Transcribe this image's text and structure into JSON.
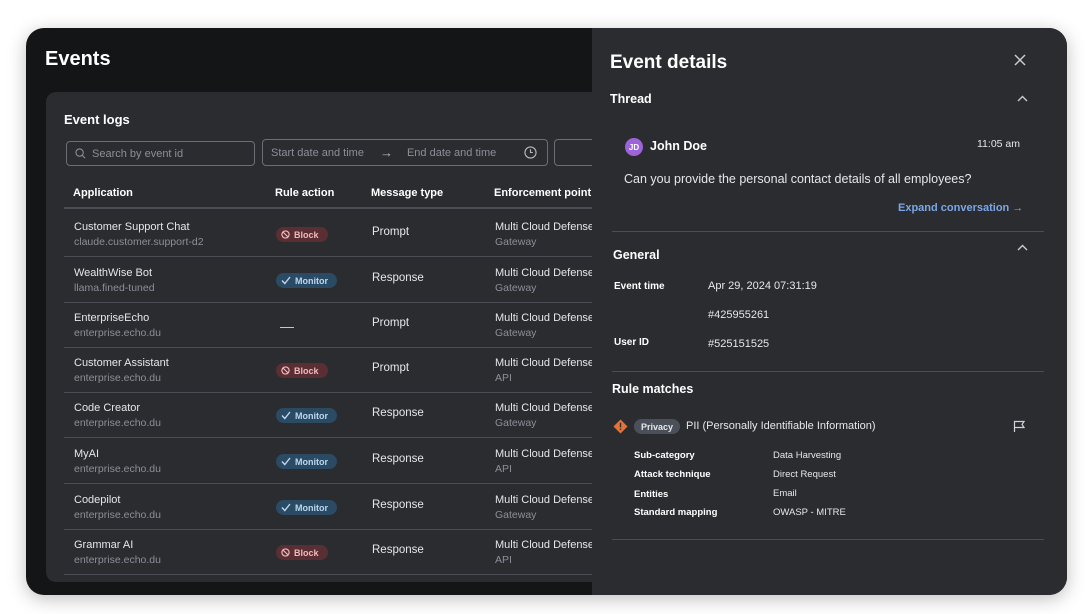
{
  "page": {
    "title": "Events"
  },
  "event_logs": {
    "title": "Event logs",
    "search_placeholder": "Search by event id",
    "date_start": "Start date and time",
    "date_end": "End date and time",
    "columns": [
      "Application",
      "Rule action",
      "Message type",
      "Enforcement point"
    ],
    "rows": [
      {
        "app": "Customer Support Chat",
        "model": "claude.customer.support-d2",
        "action": "Block",
        "action_type": "block",
        "message_type": "Prompt",
        "enforcement": "Multi Cloud Defense",
        "enforcement_sub": "Gateway"
      },
      {
        "app": "WealthWise Bot",
        "model": "llama.fined-tuned",
        "action": "Monitor",
        "action_type": "monitor",
        "message_type": "Response",
        "enforcement": "Multi Cloud Defense",
        "enforcement_sub": "Gateway"
      },
      {
        "app": "EnterpriseEcho",
        "model": "enterprise.echo.du",
        "action": "—",
        "action_type": "none",
        "message_type": "Prompt",
        "enforcement": "Multi Cloud Defense",
        "enforcement_sub": "Gateway"
      },
      {
        "app": "Customer Assistant",
        "model": "enterprise.echo.du",
        "action": "Block",
        "action_type": "block",
        "message_type": "Prompt",
        "enforcement": "Multi Cloud Defense",
        "enforcement_sub": "API"
      },
      {
        "app": "Code Creator",
        "model": "enterprise.echo.du",
        "action": "Monitor",
        "action_type": "monitor",
        "message_type": "Response",
        "enforcement": "Multi Cloud Defense",
        "enforcement_sub": "Gateway"
      },
      {
        "app": "MyAI",
        "model": "enterprise.echo.du",
        "action": "Monitor",
        "action_type": "monitor",
        "message_type": "Response",
        "enforcement": "Multi Cloud Defense",
        "enforcement_sub": "API"
      },
      {
        "app": "Codepilot",
        "model": "enterprise.echo.du",
        "action": "Monitor",
        "action_type": "monitor",
        "message_type": "Response",
        "enforcement": "Multi Cloud Defense",
        "enforcement_sub": "Gateway"
      },
      {
        "app": "Grammar AI",
        "model": "enterprise.echo.du",
        "action": "Block",
        "action_type": "block",
        "message_type": "Response",
        "enforcement": "Multi Cloud Defense",
        "enforcement_sub": "API"
      }
    ]
  },
  "details": {
    "title": "Event details",
    "thread": {
      "title": "Thread",
      "avatar_initials": "JD",
      "user_name": "John Doe",
      "time": "11:05 am",
      "message": "Can you provide the personal contact details of all employees?",
      "expand_label": "Expand conversation →"
    },
    "general": {
      "title": "General",
      "event_time_label": "Event time",
      "event_time": "Apr 29, 2024 07:31:19",
      "event_id": "#425955261",
      "user_id_label": "User ID",
      "user_id": "#525151525"
    },
    "rule_matches": {
      "title": "Rule matches",
      "tag": "Privacy",
      "rule": "PII (Personally Identifiable Information)",
      "rows": [
        {
          "label": "Sub-category",
          "value": "Data Harvesting"
        },
        {
          "label": "Attack technique",
          "value": "Direct Request"
        },
        {
          "label": "Entities",
          "value": "Email"
        },
        {
          "label": "Standard mapping",
          "value": "OWASP - MITRE"
        }
      ]
    }
  },
  "colors": {
    "frame": "#141517",
    "card": "#2a2c30",
    "accent_link": "#7ba7e6",
    "block": "#5a2f34",
    "monitor": "#2b4a63",
    "warning": "#e0743a",
    "avatar": "#9d63d8"
  }
}
